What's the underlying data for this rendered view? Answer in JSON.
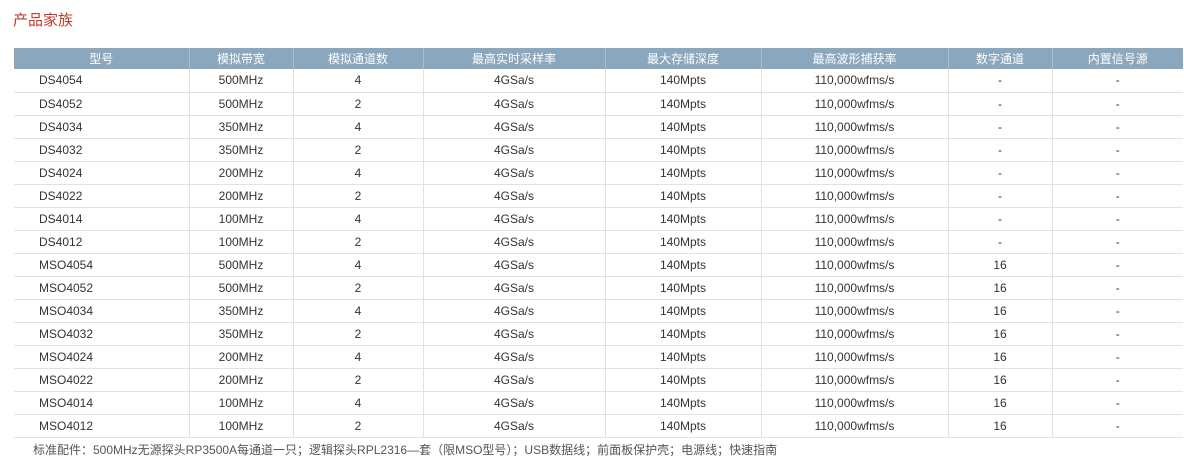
{
  "section_title": "产品家族",
  "table": {
    "headers": [
      "型号",
      "模拟带宽",
      "模拟通道数",
      "最高实时采样率",
      "最大存储深度",
      "最高波形捕获率",
      "数字通道",
      "内置信号源"
    ],
    "rows": [
      [
        "DS4054",
        "500MHz",
        "4",
        "4GSa/s",
        "140Mpts",
        "110,000wfms/s",
        "-",
        "-"
      ],
      [
        "DS4052",
        "500MHz",
        "2",
        "4GSa/s",
        "140Mpts",
        "110,000wfms/s",
        "-",
        "-"
      ],
      [
        "DS4034",
        "350MHz",
        "4",
        "4GSa/s",
        "140Mpts",
        "110,000wfms/s",
        "-",
        "-"
      ],
      [
        "DS4032",
        "350MHz",
        "2",
        "4GSa/s",
        "140Mpts",
        "110,000wfms/s",
        "-",
        "-"
      ],
      [
        "DS4024",
        "200MHz",
        "4",
        "4GSa/s",
        "140Mpts",
        "110,000wfms/s",
        "-",
        "-"
      ],
      [
        "DS4022",
        "200MHz",
        "2",
        "4GSa/s",
        "140Mpts",
        "110,000wfms/s",
        "-",
        "-"
      ],
      [
        "DS4014",
        "100MHz",
        "4",
        "4GSa/s",
        "140Mpts",
        "110,000wfms/s",
        "-",
        "-"
      ],
      [
        "DS4012",
        "100MHz",
        "2",
        "4GSa/s",
        "140Mpts",
        "110,000wfms/s",
        "-",
        "-"
      ],
      [
        "MSO4054",
        "500MHz",
        "4",
        "4GSa/s",
        "140Mpts",
        "110,000wfms/s",
        "16",
        "-"
      ],
      [
        "MSO4052",
        "500MHz",
        "2",
        "4GSa/s",
        "140Mpts",
        "110,000wfms/s",
        "16",
        "-"
      ],
      [
        "MSO4034",
        "350MHz",
        "4",
        "4GSa/s",
        "140Mpts",
        "110,000wfms/s",
        "16",
        "-"
      ],
      [
        "MSO4032",
        "350MHz",
        "2",
        "4GSa/s",
        "140Mpts",
        "110,000wfms/s",
        "16",
        "-"
      ],
      [
        "MSO4024",
        "200MHz",
        "4",
        "4GSa/s",
        "140Mpts",
        "110,000wfms/s",
        "16",
        "-"
      ],
      [
        "MSO4022",
        "200MHz",
        "2",
        "4GSa/s",
        "140Mpts",
        "110,000wfms/s",
        "16",
        "-"
      ],
      [
        "MSO4014",
        "100MHz",
        "4",
        "4GSa/s",
        "140Mpts",
        "110,000wfms/s",
        "16",
        "-"
      ],
      [
        "MSO4012",
        "100MHz",
        "2",
        "4GSa/s",
        "140Mpts",
        "110,000wfms/s",
        "16",
        "-"
      ]
    ]
  },
  "note": "标准配件：500MHz无源探头RP3500A每通道一只；逻辑探头RPL2316—套（限MSO型号）；USB数据线；前面板保护壳；电源线；快速指南",
  "colors": {
    "title": "#c0392b",
    "header_bg": "#8ba7bd",
    "header_text": "#ffffff",
    "grid_line": "#e2e2e2"
  }
}
